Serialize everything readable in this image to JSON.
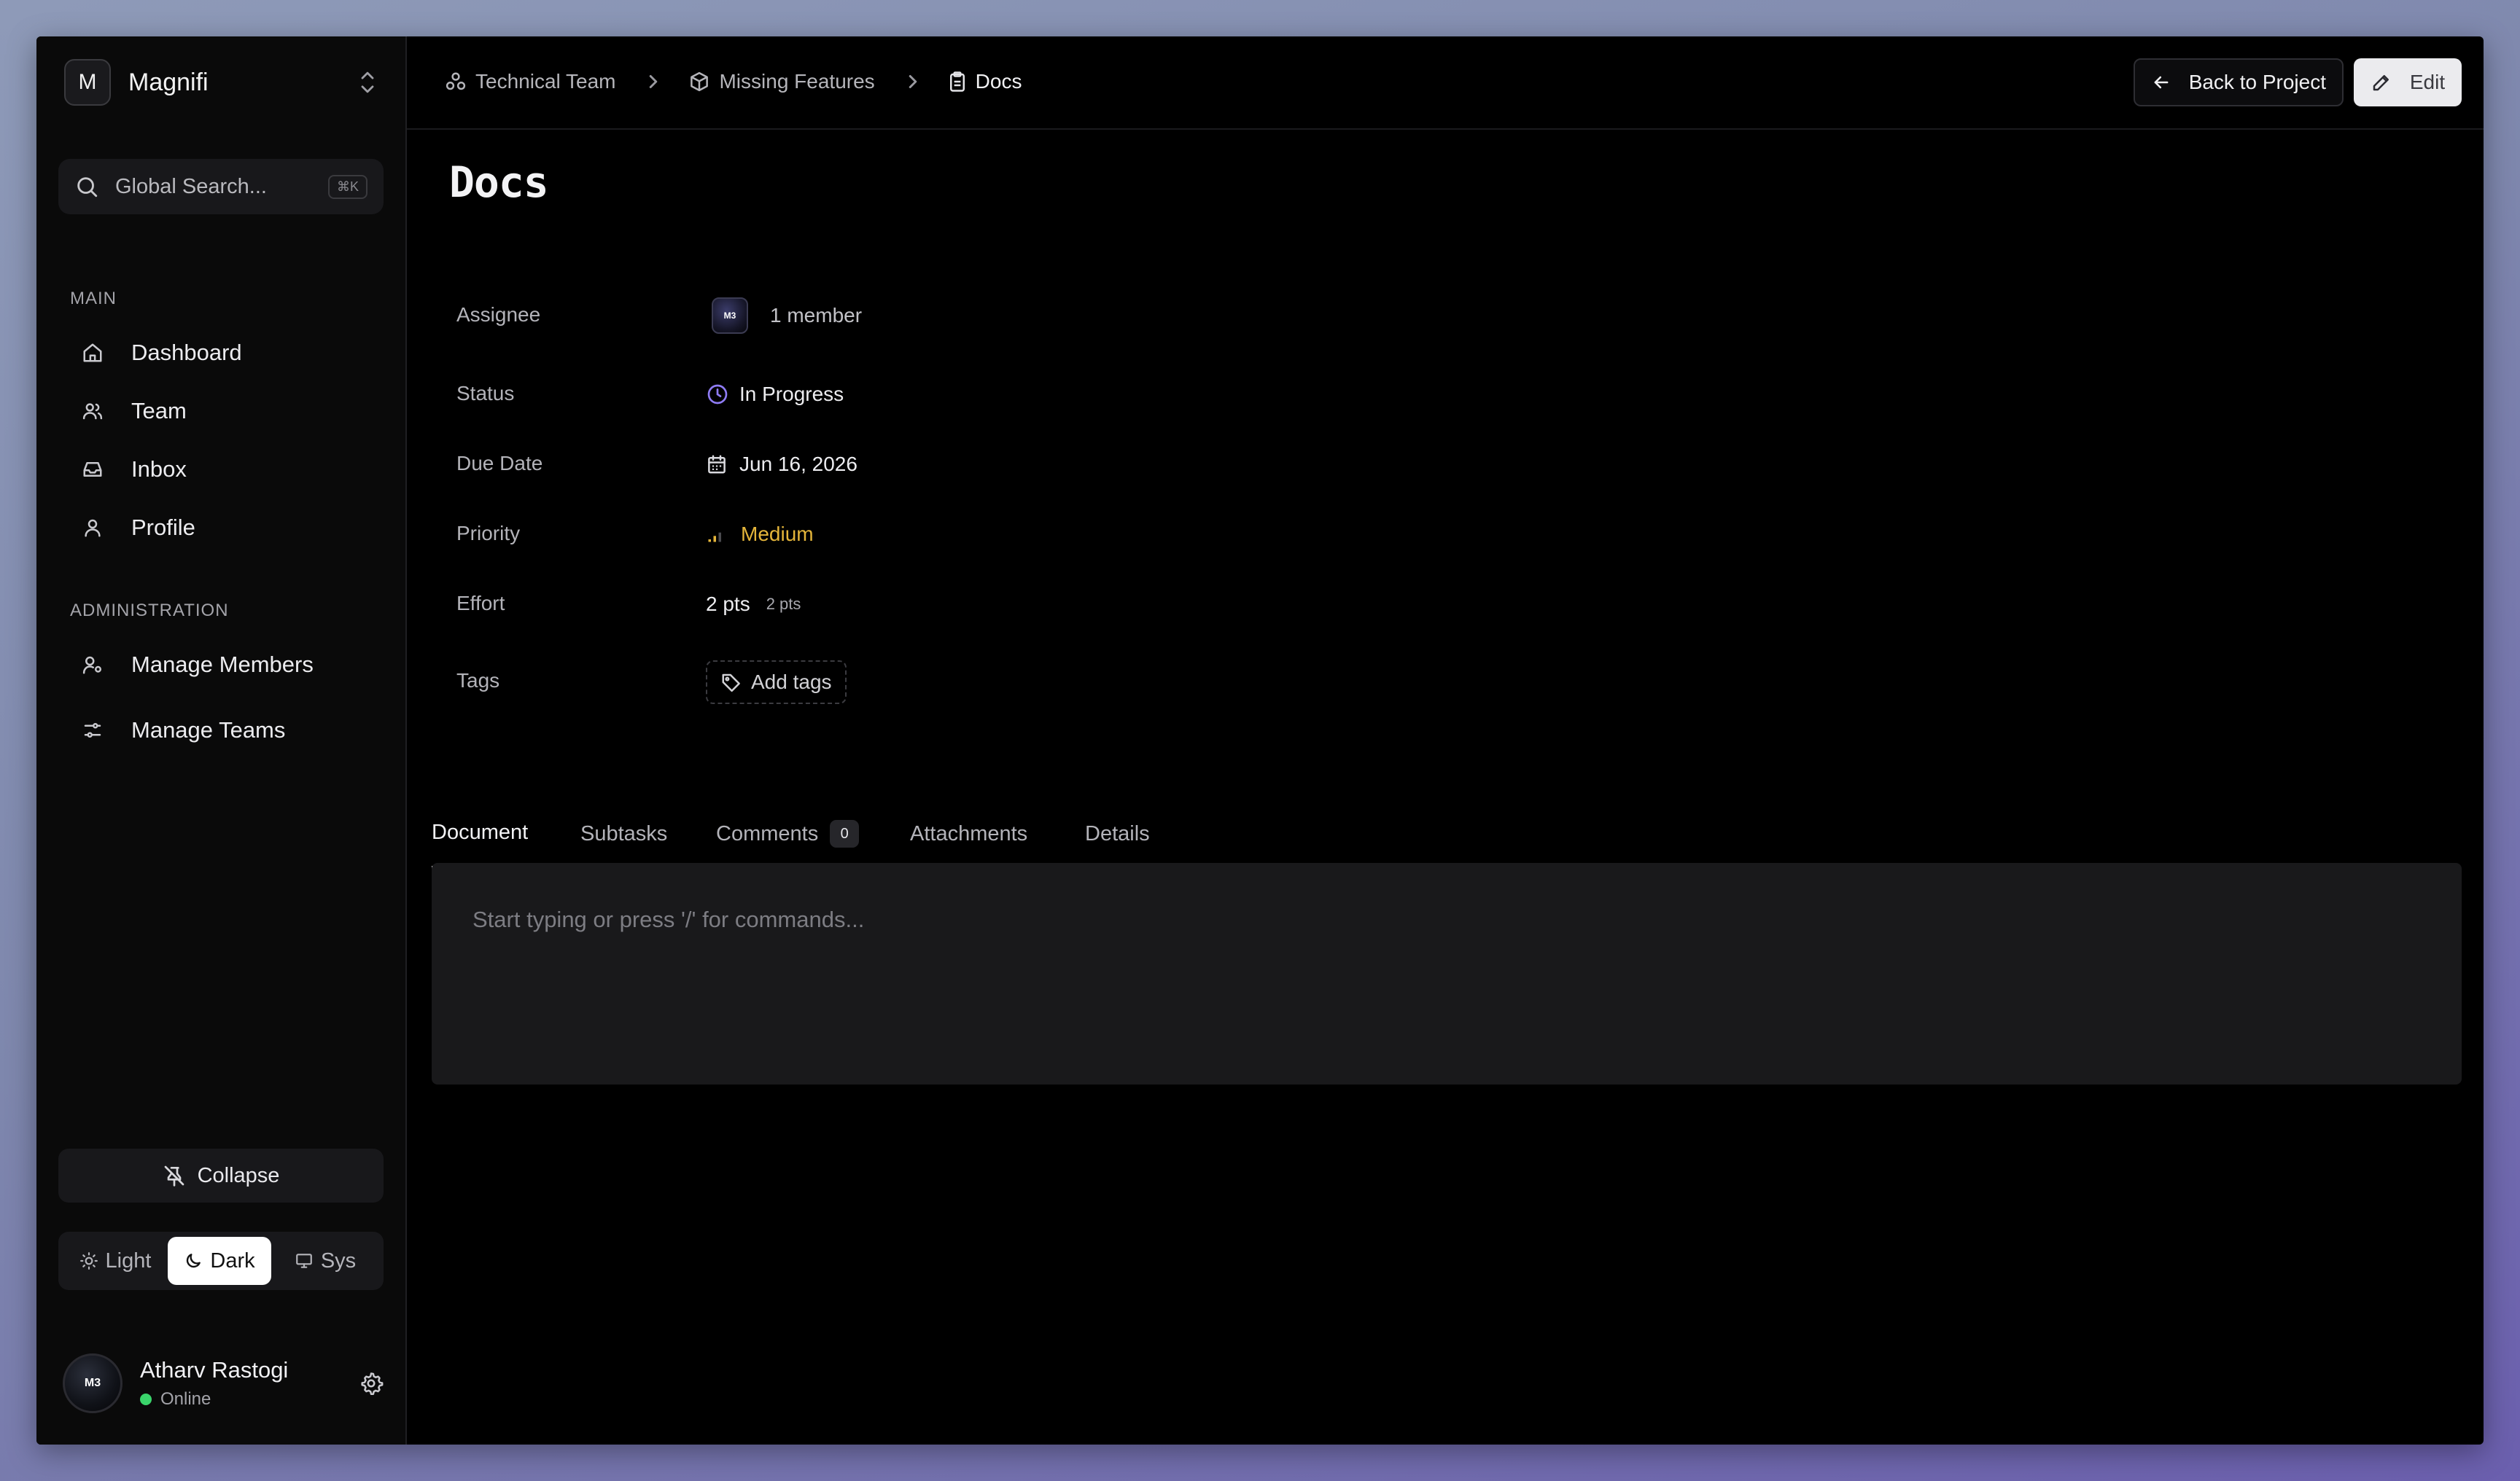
{
  "workspace": {
    "initial": "M",
    "name": "Magnifi"
  },
  "search": {
    "placeholder": "Global Search...",
    "shortcut": "⌘K"
  },
  "sidebar": {
    "main_label": "MAIN",
    "main_items": [
      {
        "label": "Dashboard",
        "icon": "home-icon"
      },
      {
        "label": "Team",
        "icon": "users-icon"
      },
      {
        "label": "Inbox",
        "icon": "inbox-icon"
      },
      {
        "label": "Profile",
        "icon": "user-icon"
      }
    ],
    "admin_label": "ADMINISTRATION",
    "admin_items": [
      {
        "label": "Manage Members",
        "icon": "user-cog-icon"
      },
      {
        "label": "Manage Teams",
        "icon": "sliders-icon"
      }
    ],
    "collapse_label": "Collapse",
    "theme": {
      "light": "Light",
      "dark": "Dark",
      "sys": "Sys",
      "selected": "Dark"
    }
  },
  "user": {
    "avatar_text": "M3",
    "name": "Atharv Rastogi",
    "status": "Online"
  },
  "breadcrumbs": [
    {
      "label": "Technical Team",
      "icon": "team-icon"
    },
    {
      "label": "Missing Features",
      "icon": "box-icon"
    },
    {
      "label": "Docs",
      "icon": "clipboard-icon"
    }
  ],
  "header": {
    "back_label": "Back to Project",
    "edit_label": "Edit"
  },
  "task": {
    "title": "Docs",
    "assignee_label": "Assignee",
    "assignee_avatar_text": "M3",
    "assignee_count": "1 member",
    "status_label": "Status",
    "status": "In Progress",
    "due_label": "Due Date",
    "due_date": "Jun 16, 2026",
    "priority_label": "Priority",
    "priority": "Medium",
    "effort_label": "Effort",
    "effort": "2 pts",
    "effort_sub": "2 pts",
    "tags_label": "Tags",
    "add_tags": "Add tags"
  },
  "tabs": [
    {
      "label": "Document",
      "active": true
    },
    {
      "label": "Subtasks"
    },
    {
      "label": "Comments",
      "badge": "0"
    },
    {
      "label": "Attachments"
    },
    {
      "label": "Details"
    }
  ],
  "editor": {
    "placeholder": "Start typing or press '/' for commands..."
  },
  "colors": {
    "accent_status": "#8f7cf5",
    "priority": "#e4b53a",
    "online": "#3ad46b"
  }
}
